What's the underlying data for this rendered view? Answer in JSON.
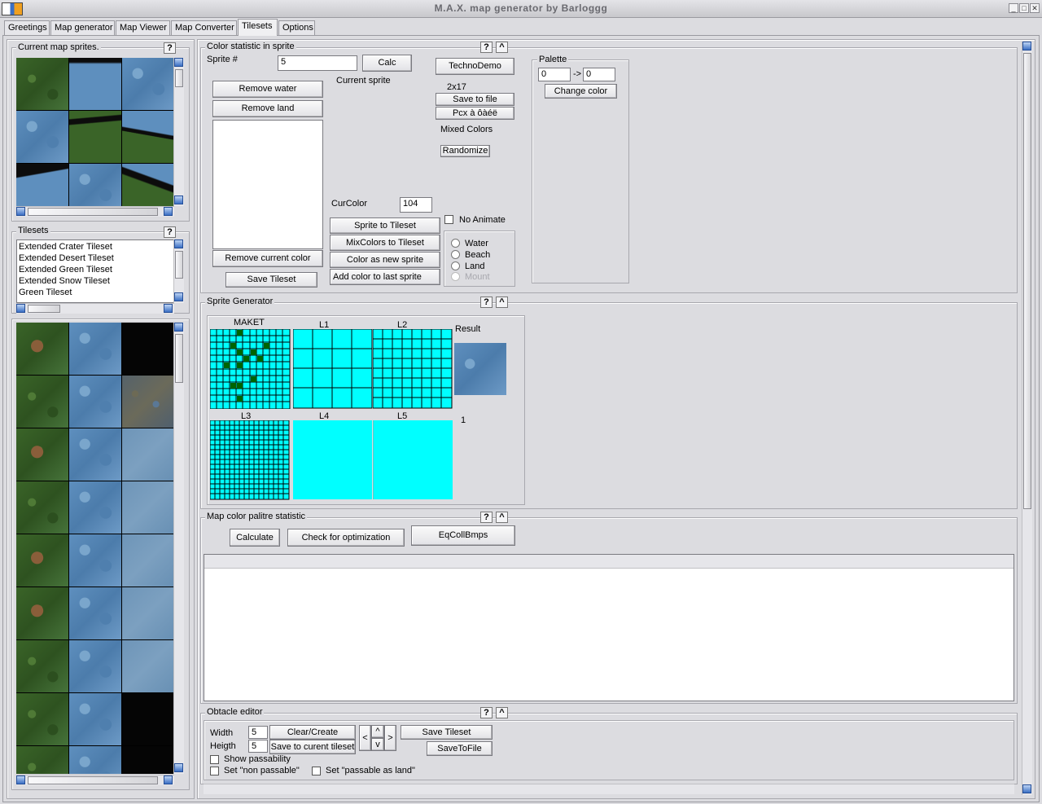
{
  "window": {
    "title": "M.A.X. map generator by Barloggg",
    "min": "_",
    "max": "□",
    "close": "✕"
  },
  "tabs": [
    "Greetings",
    "Map generator",
    "Map Viewer",
    "Map Converter",
    "Tilesets",
    "Options"
  ],
  "left": {
    "current_sprites_title": "Current map sprites.",
    "help": "?",
    "tilesets_title": "Tilesets",
    "tilesets": [
      "Extended Crater Tileset",
      "Extended Desert Tileset",
      "Extended Green Tileset",
      "Extended Snow Tileset",
      "Green Tileset"
    ]
  },
  "color_stat": {
    "title": "Color statistic in sprite",
    "sprite_label": "Sprite #",
    "sprite_value": "5",
    "calc": "Calc",
    "current_sprite": "Current sprite",
    "remove_water": "Remove water",
    "remove_land": "Remove land",
    "remove_current_color": "Remove current color",
    "save_tileset": "Save Tileset",
    "technodemo": "TechnoDemo",
    "size": "2x17",
    "save_to_file": "Save to file",
    "pcx": "Pcx à ôàéë",
    "mixed_colors": "Mixed Colors",
    "randomize": "Randomize",
    "curcolor_label": "CurColor",
    "curcolor_value": "104",
    "sprite_to_tileset": "Sprite to Tileset",
    "mixcolors_to_tileset": "MixColors to Tileset",
    "color_as_new_sprite": "Color as new sprite",
    "add_color_to_last": "Add color to last sprite",
    "no_animate": "No Animate",
    "radios": [
      "Water",
      "Beach",
      "Land",
      "Mount"
    ],
    "palette_title": "Palette",
    "palette_from": "0",
    "palette_arrow": "->",
    "palette_to": "0",
    "change_color": "Change color",
    "help": "?",
    "collapse": "^"
  },
  "sprite_gen": {
    "title": "Sprite Generator",
    "maket": "MAKET",
    "l1": "L1",
    "l2": "L2",
    "l3": "L3",
    "l4": "L4",
    "l5": "L5",
    "result": "Result",
    "result_value": "1",
    "help": "?",
    "collapse": "^"
  },
  "palette_stat": {
    "title": "Map color palitre statistic",
    "calculate": "Calculate",
    "check_opt": "Check for optimization",
    "eqcoll": "EqCollBmps",
    "help": "?",
    "collapse": "^"
  },
  "obstacle": {
    "title": "Obtacle editor",
    "width_label": "Width",
    "width_value": "5",
    "height_label": "Heigth",
    "height_value": "5",
    "clear_create": "Clear/Create",
    "save_to_current": "Save to curent tileset",
    "save_tileset": "Save Tileset",
    "save_to_file": "SaveToFile",
    "left": "<",
    "up": "^",
    "down": "v",
    "right": ">",
    "show_passability": "Show passability",
    "set_non_passable": "Set \"non passable\"",
    "set_passable_land": "Set \"passable as land\"",
    "help": "?",
    "collapse": "^"
  },
  "colors": {
    "cyan": "#00ffff",
    "maket_green": "#006400"
  }
}
